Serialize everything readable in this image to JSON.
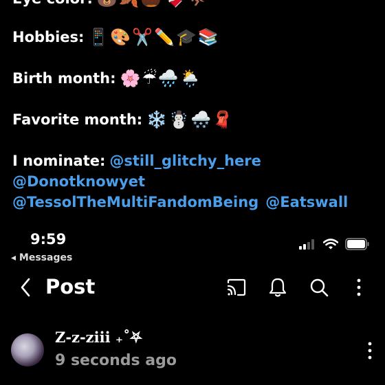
{
  "profile": {
    "eye_label": "Eye color:",
    "eye_emojis": "🐻🍂🌰🍫🦘",
    "hobbies_label": "Hobbies:",
    "hobbies_emojis": "📱🎨✂️✏️🎓📚",
    "birth_label": "Birth month:",
    "birth_emojis": "🌸☔🌧️🌦️",
    "fav_label": "Favorite month:",
    "fav_emojis": "❄️☃️🌨️🧣",
    "nominate_label": "I nominate:",
    "mentions": [
      "@still_glitchy_here",
      "@Donotknowyet",
      "@TessolTheMultiFandomBeing",
      "@Eatswall"
    ]
  },
  "status_bar": {
    "time": "9:59",
    "back_app": "◂ Messages"
  },
  "header": {
    "title": "Post"
  },
  "post": {
    "username": "Z-z-ziii ₊˚⛧",
    "time_ago": "9 seconds ago"
  },
  "colors": {
    "background": "#000000",
    "mention": "#4a9eea",
    "secondary_text": "#9a9a9a"
  }
}
